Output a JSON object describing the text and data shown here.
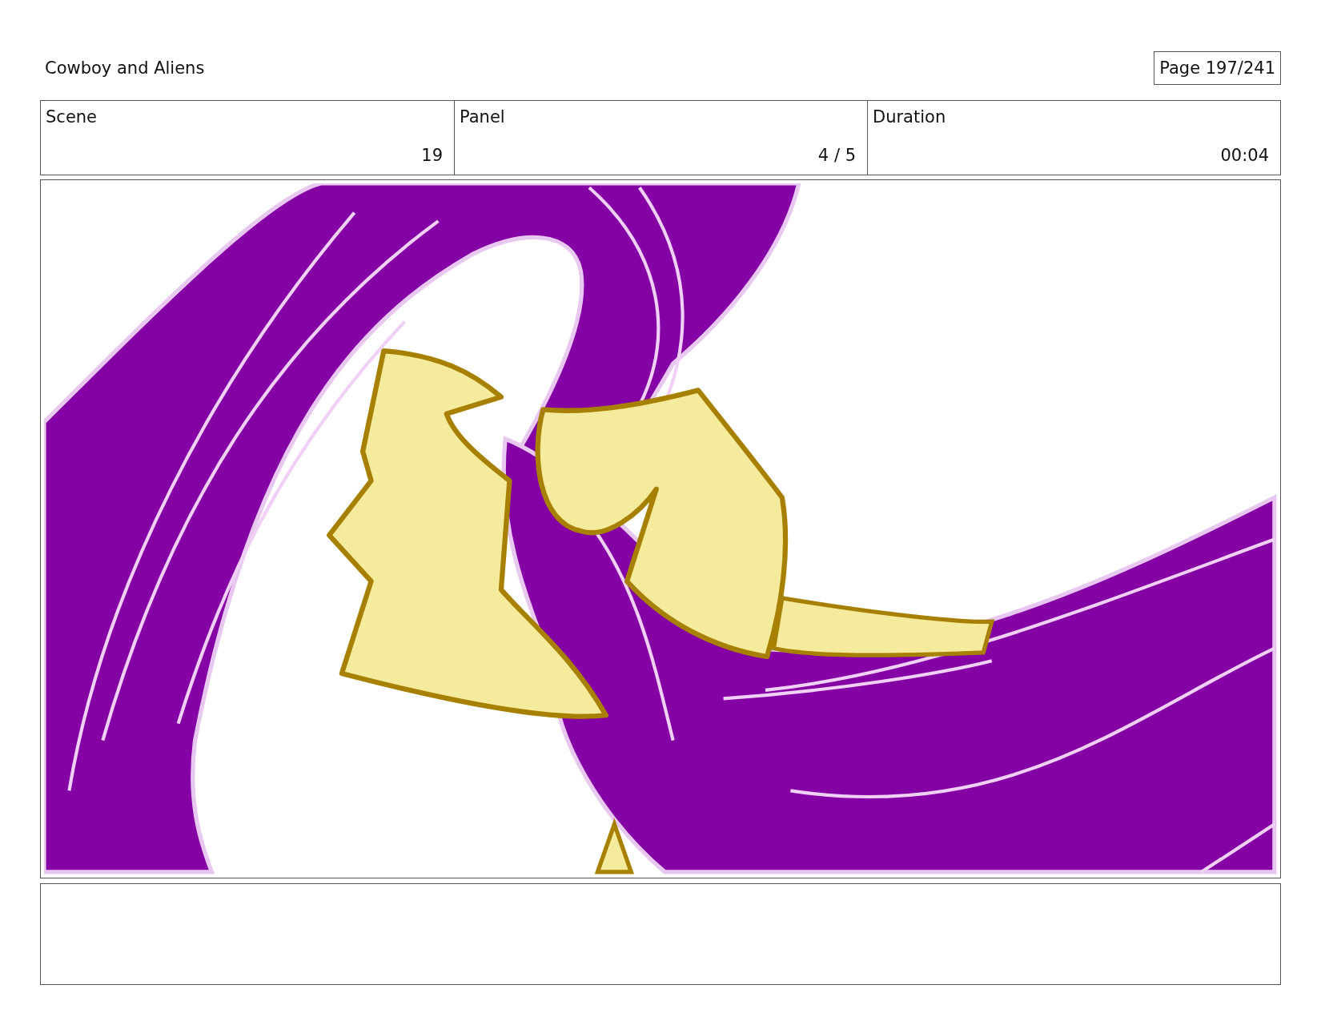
{
  "header": {
    "title": "Cowboy and Aliens",
    "page": "Page 197/241"
  },
  "fields": [
    {
      "label": "Scene",
      "value": "19"
    },
    {
      "label": "Panel",
      "value": "4 / 5"
    },
    {
      "label": "Duration",
      "value": "00:04"
    }
  ]
}
